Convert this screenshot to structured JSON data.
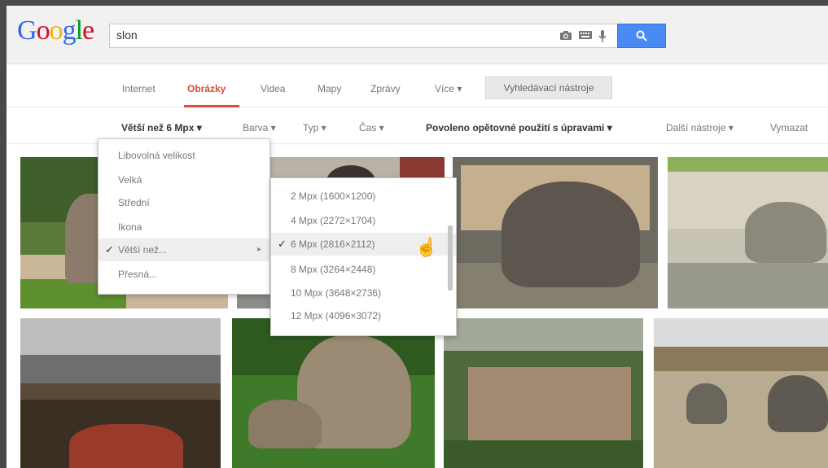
{
  "logo": {
    "letters": [
      "G",
      "o",
      "o",
      "g",
      "l",
      "e"
    ],
    "colors": [
      "#3369e8",
      "#d50f25",
      "#eeb211",
      "#3369e8",
      "#009925",
      "#d50f25"
    ]
  },
  "search": {
    "query": "slon",
    "camera_icon": "camera-icon",
    "keyboard_icon": "keyboard-icon",
    "mic_icon": "microphone-icon",
    "button_icon": "search-icon"
  },
  "tabs": [
    {
      "label": "Internet"
    },
    {
      "label": "Obrázky"
    },
    {
      "label": "Videa"
    },
    {
      "label": "Mapy"
    },
    {
      "label": "Zprávy"
    },
    {
      "label": "Více ▾"
    }
  ],
  "tools_button": "Vyhledávací nástroje",
  "filters": {
    "size": "Větší než 6 Mpx ▾",
    "color": "Barva ▾",
    "type": "Typ ▾",
    "time": "Čas ▾",
    "usage": "Povoleno opětovné použití s úpravami ▾",
    "more_tools": "Další nástroje ▾",
    "clear": "Vymazat"
  },
  "size_menu": {
    "items": [
      "Libovolná velikost",
      "Velká",
      "Střední",
      "Ikona",
      "Větší než...",
      "Přesná..."
    ],
    "checked": "✓",
    "submenu_arrow": "▸"
  },
  "mpx_menu": {
    "items": [
      "2 Mpx (1600×1200)",
      "4 Mpx (2272×1704)",
      "6 Mpx (2816×2112)",
      "8 Mpx (3264×2448)",
      "10 Mpx (3648×2736)",
      "12 Mpx (4096×3072)"
    ],
    "checked": "✓"
  },
  "cursor_icon": "☝",
  "accent": {
    "active_tab": "#dd4b39",
    "search_button": "#4a8af4"
  }
}
